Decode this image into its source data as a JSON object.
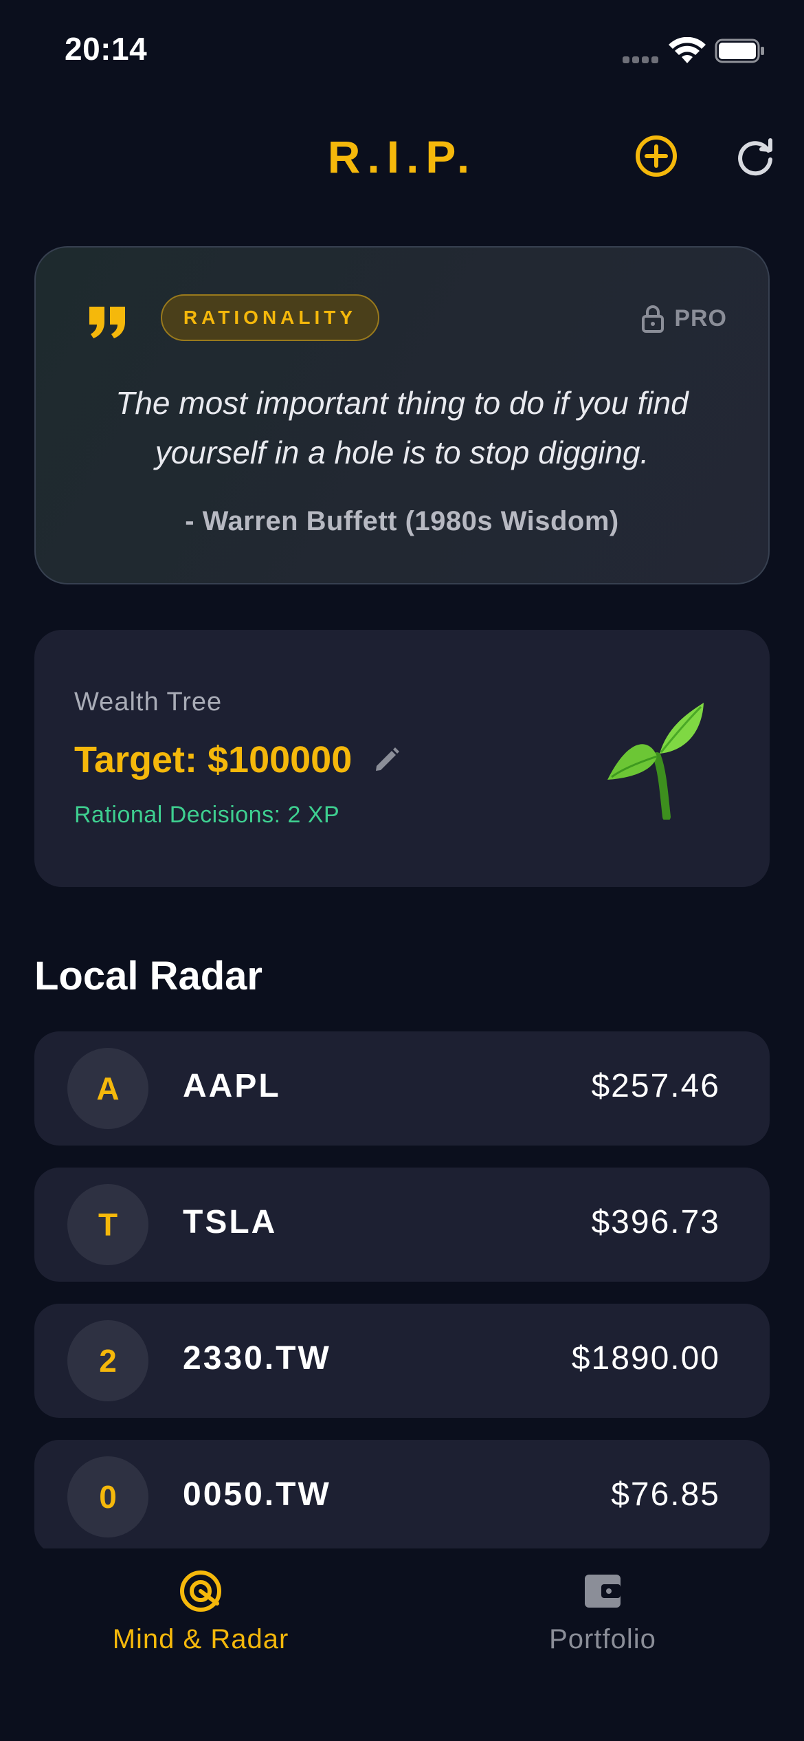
{
  "status_bar": {
    "time": "20:14"
  },
  "header": {
    "title": "R.I.P."
  },
  "quote_card": {
    "category": "RATIONALITY",
    "pro_label": "PRO",
    "quote": "The most important thing to do if you find yourself in a hole is to stop digging.",
    "author": "- Warren Buffett (1980s Wisdom)"
  },
  "wealth": {
    "label": "Wealth Tree",
    "target": "Target: $100000",
    "xp": "Rational Decisions: 2 XP"
  },
  "radar": {
    "title": "Local Radar",
    "items": [
      {
        "initial": "A",
        "symbol": "AAPL",
        "price": "$257.46"
      },
      {
        "initial": "T",
        "symbol": "TSLA",
        "price": "$396.73"
      },
      {
        "initial": "2",
        "symbol": "2330.TW",
        "price": "$1890.00"
      },
      {
        "initial": "0",
        "symbol": "0050.TW",
        "price": "$76.85"
      }
    ]
  },
  "tabs": [
    {
      "label": "Mind & Radar",
      "active": true
    },
    {
      "label": "Portfolio",
      "active": false
    }
  ],
  "colors": {
    "accent": "#f5b80b",
    "background": "#0b0f1d",
    "card": "#1d2032",
    "xp_green": "#3ecf90",
    "inactive": "#8b8e98"
  },
  "icons": {
    "add": "plus-circle-icon",
    "refresh": "refresh-icon",
    "quote": "quote-icon",
    "lock": "lock-icon",
    "edit": "pencil-icon",
    "tree": "sprout-icon",
    "mind_tab": "radar-target-icon",
    "portfolio_tab": "wallet-icon"
  }
}
